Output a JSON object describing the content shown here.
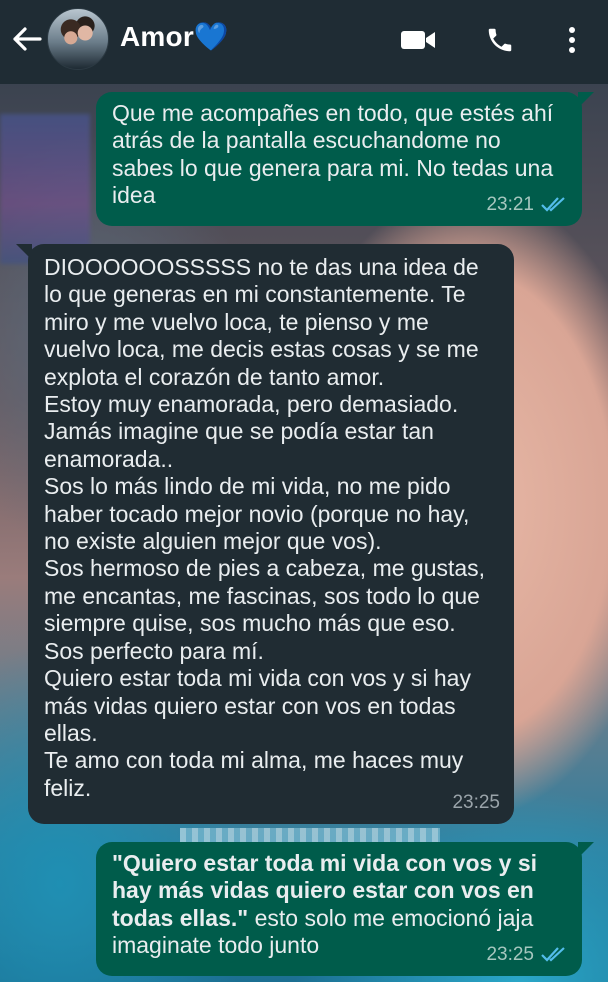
{
  "header": {
    "contact_name": "Amor",
    "contact_emoji": "💙",
    "icons": [
      "back-arrow-icon",
      "video-call-icon",
      "phone-icon",
      "more-options-icon"
    ]
  },
  "messages": [
    {
      "direction": "outgoing",
      "text": "Que me acompañes en todo, que estés ahí atrás de la pantalla escuchandome no sabes lo que genera para mi. No tedas una idea",
      "time": "23:21",
      "status": "read"
    },
    {
      "direction": "incoming",
      "text": "DIOOOOOOSSSSS no te das una idea de lo que generas en mi constantemente. Te miro y me vuelvo loca, te pienso y me vuelvo loca, me decis estas cosas y se me explota el corazón de tanto amor.\nEstoy muy enamorada, pero demasiado. Jamás imagine que se podía estar tan enamorada..\nSos lo más lindo de mi vida, no me pido haber tocado mejor novio (porque no hay, no existe alguien mejor que vos).\nSos hermoso de pies a cabeza, me gustas, me encantas, me fascinas, sos todo lo que siempre quise, sos mucho más que eso.\nSos perfecto para mí.\nQuiero estar toda mi vida con vos y si hay más vidas quiero estar con vos en todas ellas.\nTe amo con toda mi alma, me haces muy feliz.",
      "time": "23:25"
    },
    {
      "direction": "outgoing",
      "quote": "\"Quiero estar toda mi vida con vos y si hay más vidas quiero estar con vos en todas ellas.\"",
      "text": " esto solo me emocionó jaja imaginate todo junto",
      "time": "23:25",
      "status": "read"
    }
  ],
  "colors": {
    "header_bg": "#1f2c34",
    "outgoing_bubble": "#005c4b",
    "incoming_bubble": "#202c33",
    "read_ticks": "#53bdeb"
  }
}
